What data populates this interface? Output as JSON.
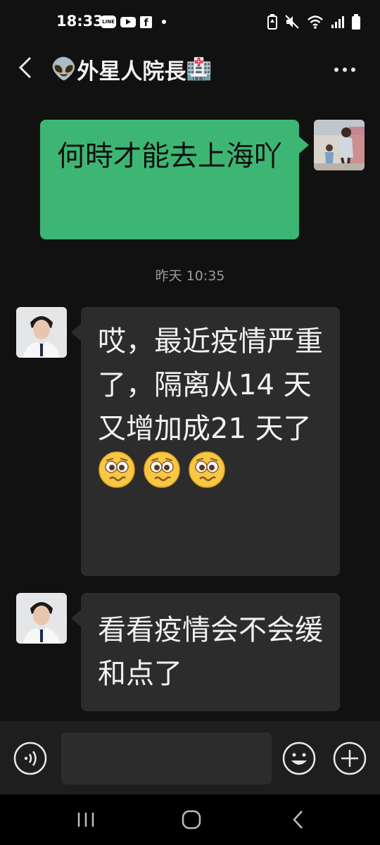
{
  "status_bar": {
    "time": "18:33",
    "app_icons": [
      "line-icon",
      "youtube-icon",
      "facebook-icon"
    ],
    "line_label": "LINE",
    "facebook_label": "f",
    "right_icons": [
      "battery-saver-icon",
      "mute-icon",
      "wifi-icon",
      "signal-icon",
      "battery-icon"
    ]
  },
  "nav": {
    "title_prefix_emoji": "👽",
    "title": "外星人院長",
    "title_suffix_emoji": "🏥"
  },
  "messages": [
    {
      "sender": "me",
      "text": "何時才能去上海吖"
    },
    {
      "sender": "contact",
      "text": "哎，最近疫情严重了，隔离从14 天又增加成21 天了",
      "emojis": [
        "woozy-face",
        "woozy-face",
        "woozy-face"
      ]
    },
    {
      "sender": "contact",
      "text": "看看疫情会不会缓和点了"
    }
  ],
  "timestamp": "昨天 10:35",
  "input_bar": {
    "placeholder": "",
    "buttons": [
      "voice-icon",
      "emoji-icon",
      "add-icon"
    ]
  },
  "colors": {
    "background": "#111111",
    "outgoing_bubble": "#3db674",
    "incoming_bubble": "#2c2c2c",
    "timestamp": "#9a9a9a",
    "input_bar": "#1e1e1e"
  }
}
